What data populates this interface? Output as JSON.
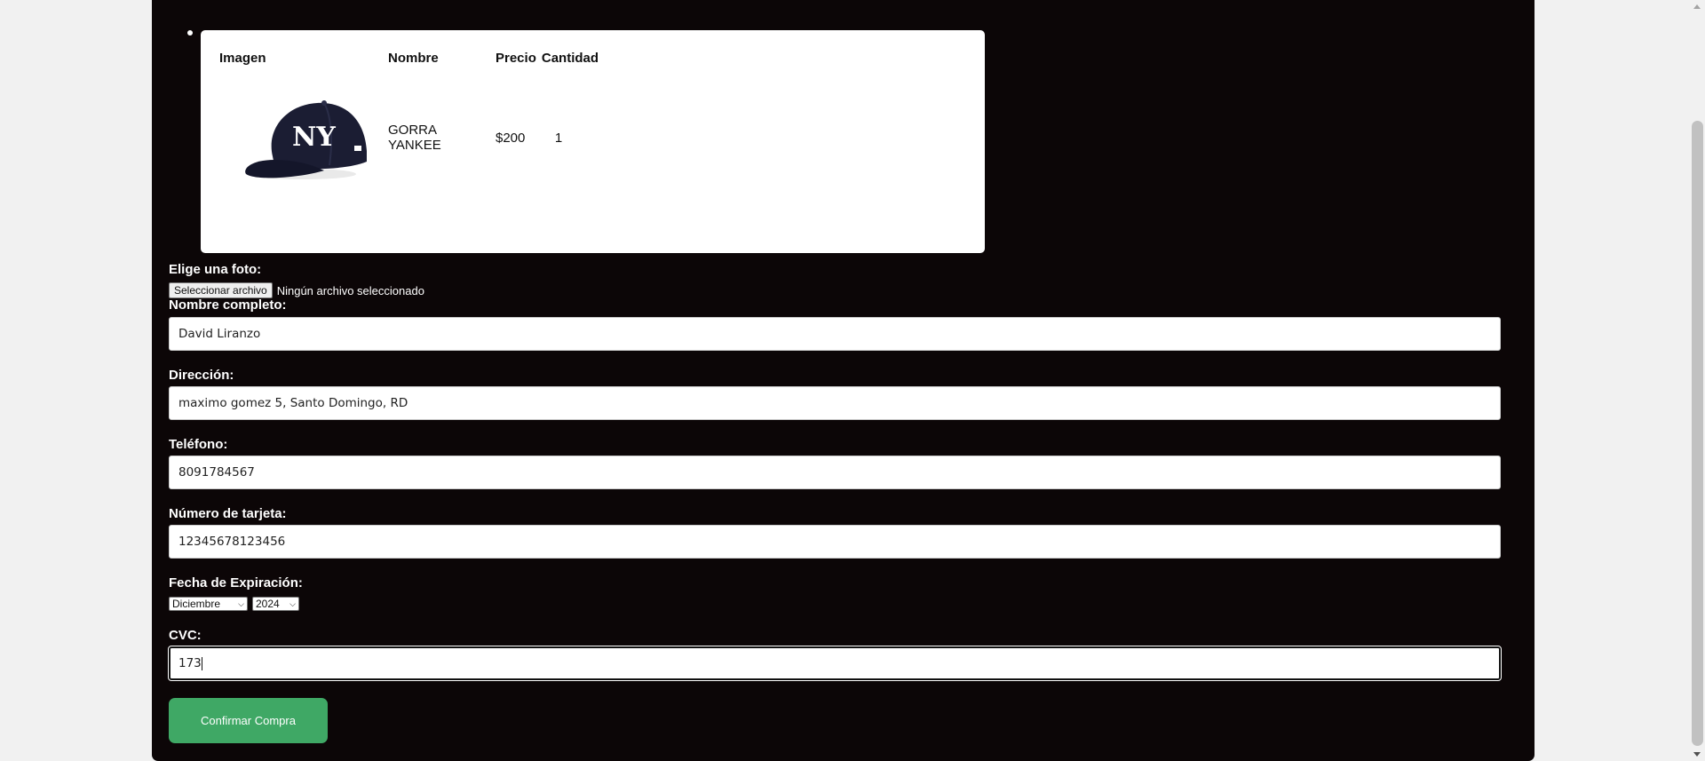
{
  "cart": {
    "headers": {
      "image": "Imagen",
      "name": "Nombre",
      "price": "Precio",
      "quantity": "Cantidad"
    },
    "item": {
      "image_label": "GORRA YANKEE product image (navy New York Yankees cap)",
      "name": "GORRA YANKEE",
      "price": "$200",
      "quantity": "1"
    }
  },
  "form": {
    "photo_label": "Elige una foto:",
    "file_button": "Seleccionar archivo",
    "file_status": "Ningún archivo seleccionado",
    "name_label": "Nombre completo:",
    "name_value": "David Liranzo",
    "address_label": "Dirección:",
    "address_value": "maximo gomez 5, Santo Domingo, RD",
    "phone_label": "Teléfono:",
    "phone_value": "8091784567",
    "card_label": "Número de tarjeta:",
    "card_value": "12345678123456",
    "expiry_label": "Fecha de Expiración:",
    "expiry_month": "Diciembre",
    "expiry_year": "2024",
    "cvc_label": "CVC:",
    "cvc_value": "173",
    "confirm_button": "Confirmar Compra"
  },
  "colors": {
    "page_background": "#0c0607",
    "confirm_button": "#3fa865",
    "card_background": "#ffffff"
  }
}
